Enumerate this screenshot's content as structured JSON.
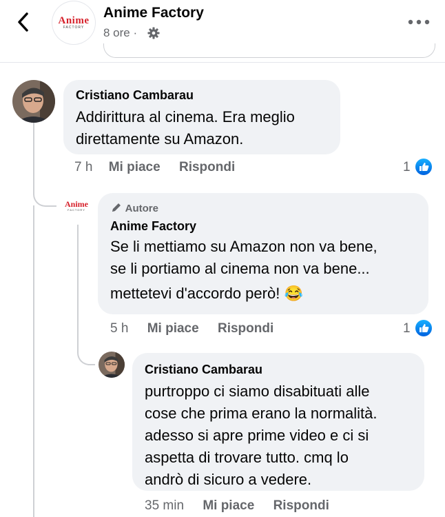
{
  "header": {
    "page_name": "Anime Factory",
    "time": "8 ore",
    "separator": "·",
    "logo_text": "Anime",
    "logo_sub": "FACTORY"
  },
  "comments": [
    {
      "author": "Cristiano Cambarau",
      "lines": [
        "Addirittura al cinema. Era meglio",
        "direttamente su Amazon."
      ],
      "time": "7 h",
      "like_label": "Mi piace",
      "reply_label": "Rispondi",
      "reactions": "1"
    },
    {
      "badge": "Autore",
      "author": "Anime Factory",
      "lines": [
        "Se li mettiamo su Amazon non va bene,",
        "se li portiamo al cinema non va bene...",
        "mettetevi d'accordo però!"
      ],
      "emoji": "😂",
      "time": "5 h",
      "like_label": "Mi piace",
      "reply_label": "Rispondi",
      "reactions": "1"
    },
    {
      "author": "Cristiano Cambarau",
      "lines": [
        "purtroppo ci siamo disabituati alle",
        "cose che prima erano la normalità.",
        "adesso si apre prime video e ci si",
        "aspetta di trovare tutto. cmq lo",
        "andrò di sicuro a vedere."
      ],
      "time": "35 min",
      "like_label": "Mi piace",
      "reply_label": "Rispondi"
    }
  ],
  "colors": {
    "bubble": "#f0f2f5",
    "meta_text": "#65676b",
    "like_blue": "#0866ff",
    "logo_red": "#d6202a"
  }
}
